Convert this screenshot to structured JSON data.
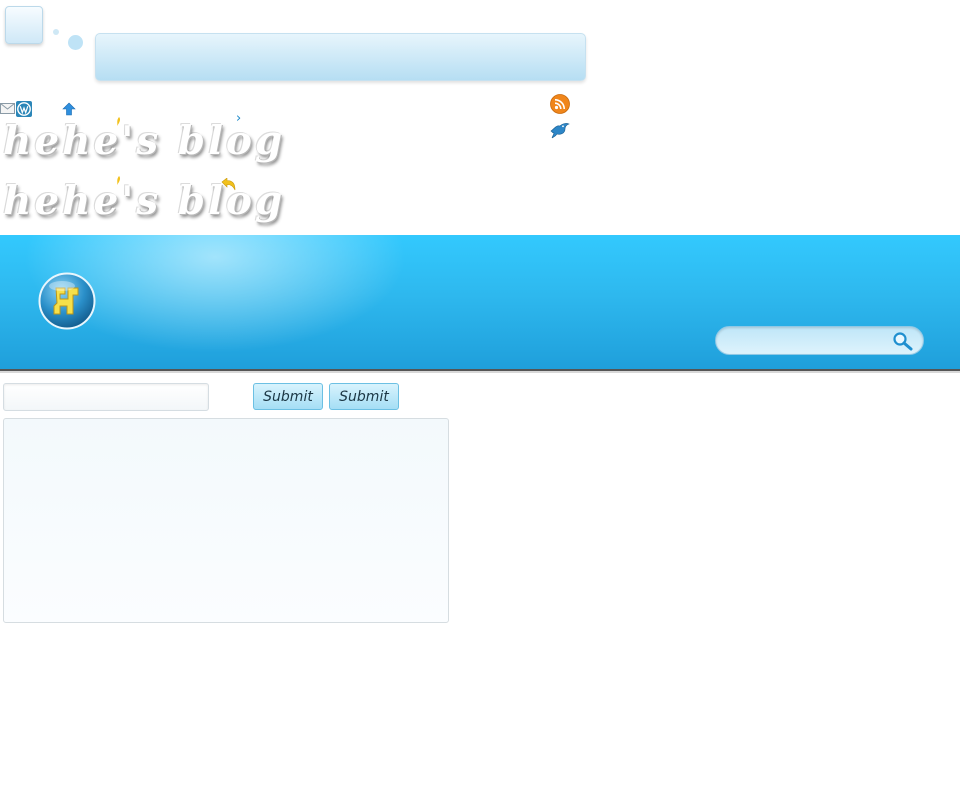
{
  "site": {
    "logo_text_primary": "hehe's blog",
    "logo_text_secondary": "hehe's blog"
  },
  "icons": {
    "mail": "mail-icon",
    "wordpress": "wordpress-icon",
    "up_arrow": "arrow-up-icon",
    "chevron": "chevron-right-icon",
    "rss": "rss-icon",
    "twitter": "bird-icon",
    "back": "reply-arrow-icon",
    "badge": "site-badge-icon",
    "search": "search-icon"
  },
  "chevron_glyph": "›",
  "header": {
    "search": {
      "placeholder": "",
      "value": ""
    }
  },
  "form": {
    "input_value": "",
    "input_placeholder": "",
    "submit_1_label": "Submit",
    "submit_2_label": "Submit",
    "textarea_value": ""
  },
  "colors": {
    "header_top": "#33c9fe",
    "header_bottom": "#1f9fdb",
    "button_top": "#d8f3fd",
    "button_bottom": "#a5def5",
    "accent": "#1a88c9"
  }
}
